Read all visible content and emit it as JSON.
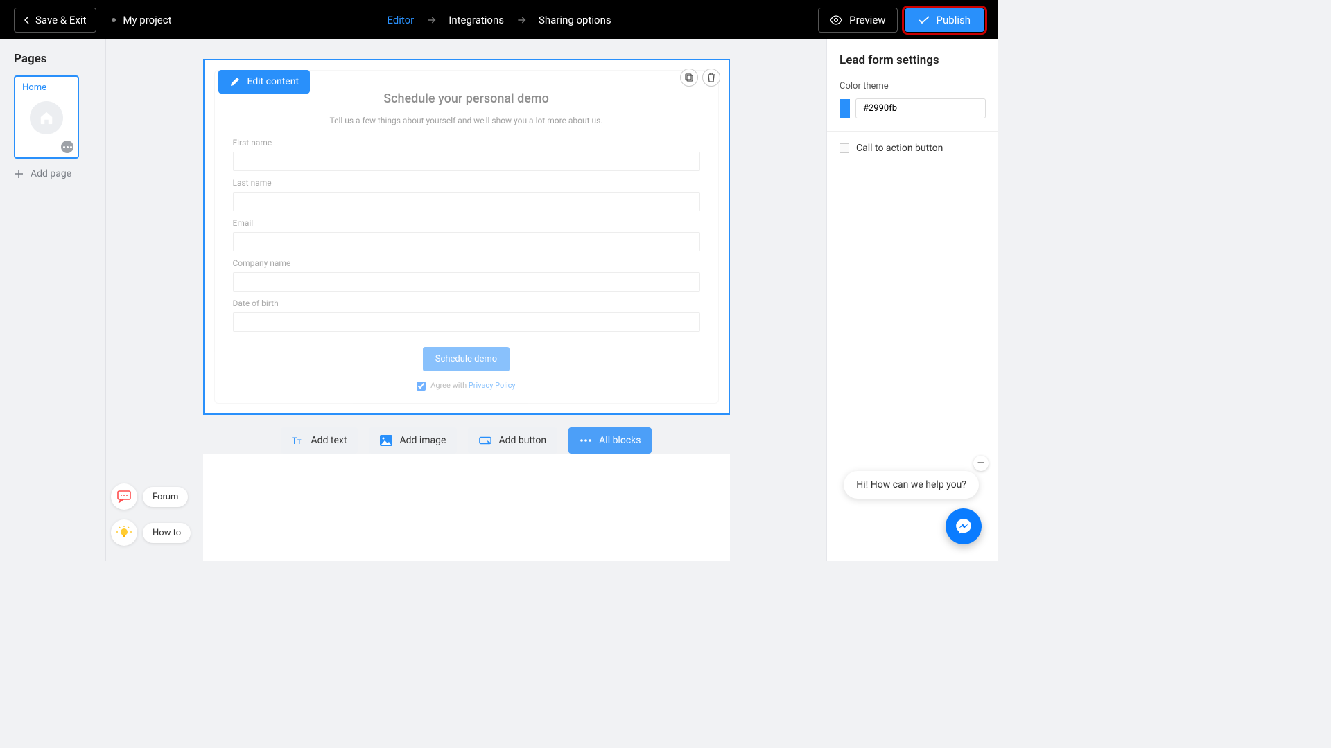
{
  "topbar": {
    "save_exit": "Save & Exit",
    "project_name": "My project",
    "steps": [
      "Editor",
      "Integrations",
      "Sharing options"
    ],
    "preview": "Preview",
    "publish": "Publish"
  },
  "left_sidebar": {
    "title": "Pages",
    "pages": [
      {
        "label": "Home"
      }
    ],
    "add_page": "Add page"
  },
  "block_toolbar": {
    "edit_content": "Edit content"
  },
  "lead_form": {
    "title": "Schedule your personal demo",
    "subtitle": "Tell us a few things about yourself and we'll show you a lot more about us.",
    "fields": [
      {
        "label": "First name"
      },
      {
        "label": "Last name"
      },
      {
        "label": "Email"
      },
      {
        "label": "Company name"
      },
      {
        "label": "Date of birth"
      }
    ],
    "submit": "Schedule demo",
    "agree_prefix": "Agree with ",
    "agree_link": "Privacy Policy"
  },
  "add_row": {
    "text": "Add text",
    "image": "Add image",
    "button": "Add button",
    "all": "All blocks"
  },
  "right_sidebar": {
    "title": "Lead form settings",
    "color_label": "Color theme",
    "color_value": "#2990fb",
    "cta_label": "Call to action button"
  },
  "help": {
    "forum": "Forum",
    "howto": "How to"
  },
  "chat": {
    "message": "Hi! How can we help you?"
  }
}
